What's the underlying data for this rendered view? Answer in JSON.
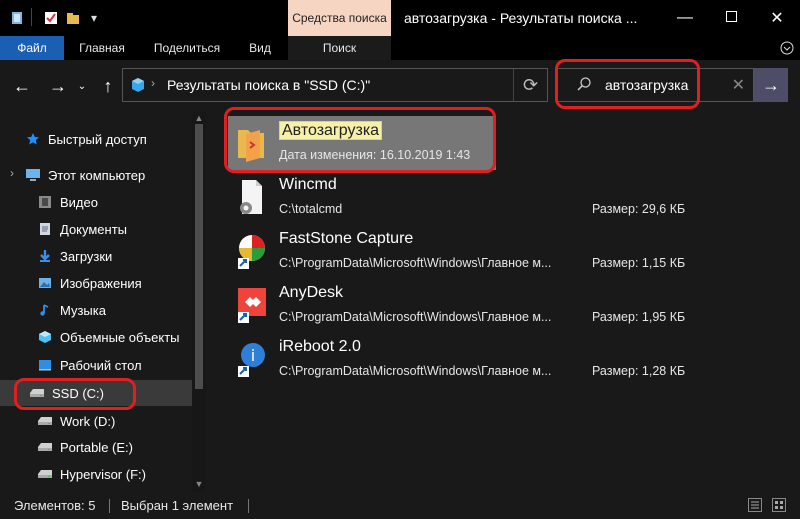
{
  "quick_access": [
    "folder-icon",
    "properties-icon",
    "new-folder-icon",
    "customize-icon"
  ],
  "ribbon": {
    "context_tab": "Средства поиска",
    "tabs": [
      "Файл",
      "Главная",
      "Поделиться",
      "Вид",
      "Поиск"
    ]
  },
  "window": {
    "title": "автозагрузка - Результаты поиска ...",
    "buttons": [
      "minimize",
      "maximize",
      "close"
    ]
  },
  "address": {
    "path": "Результаты поиска в \"SSD (C:)\""
  },
  "search": {
    "query": "автозагрузка"
  },
  "sidebar": {
    "items": [
      {
        "label": "Быстрый доступ",
        "icon": "star-icon",
        "color": "#1e90ff"
      },
      {
        "label": "Этот компьютер",
        "icon": "computer-icon",
        "color": "#6cb4ee"
      },
      {
        "label": "Видео",
        "icon": "video-icon",
        "color": "#8a8a8a"
      },
      {
        "label": "Документы",
        "icon": "documents-icon",
        "color": "#cfd8e3"
      },
      {
        "label": "Загрузки",
        "icon": "downloads-icon",
        "color": "#3a8ee6"
      },
      {
        "label": "Изображения",
        "icon": "pictures-icon",
        "color": "#6ab2e8"
      },
      {
        "label": "Музыка",
        "icon": "music-icon",
        "color": "#2f8de4"
      },
      {
        "label": "Объемные объекты",
        "icon": "3d-objects-icon",
        "color": "#4fc3f7"
      },
      {
        "label": "Рабочий стол",
        "icon": "desktop-icon",
        "color": "#2f8de4"
      },
      {
        "label": "SSD (C:)",
        "icon": "drive-icon",
        "color": "#aaaaaa",
        "selected": true
      },
      {
        "label": "Work (D:)",
        "icon": "drive-icon",
        "color": "#aaaaaa"
      },
      {
        "label": "Portable (E:)",
        "icon": "drive-icon",
        "color": "#aaaaaa"
      },
      {
        "label": "Hypervisor (F:)",
        "icon": "drive-icon",
        "color": "#aaaaaa"
      }
    ]
  },
  "results": [
    {
      "name": "Автозагрузка",
      "detail": "Дата изменения: 16.10.2019 1:43",
      "size": "",
      "icon": "folder-icon",
      "selected": true
    },
    {
      "name": "Wincmd",
      "detail": "C:\\totalcmd",
      "size": "Размер: 29,6 КБ",
      "icon": "settings-file-icon"
    },
    {
      "name": "FastStone Capture",
      "detail": "C:\\ProgramData\\Microsoft\\Windows\\Главное м...",
      "size": "Размер: 1,15 КБ",
      "icon": "faststone-icon"
    },
    {
      "name": "AnyDesk",
      "detail": "C:\\ProgramData\\Microsoft\\Windows\\Главное м...",
      "size": "Размер: 1,95 КБ",
      "icon": "anydesk-icon"
    },
    {
      "name": "iReboot 2.0",
      "detail": "C:\\ProgramData\\Microsoft\\Windows\\Главное м...",
      "size": "Размер: 1,28 КБ",
      "icon": "ireboot-icon"
    }
  ],
  "status": {
    "count": "Элементов: 5",
    "selection": "Выбран 1 элемент"
  },
  "colors": {
    "accent": "#1a5fb4",
    "annotation": "#e02020",
    "context_tab": "#f6d6c3",
    "highlight": "#f6f1a9"
  }
}
